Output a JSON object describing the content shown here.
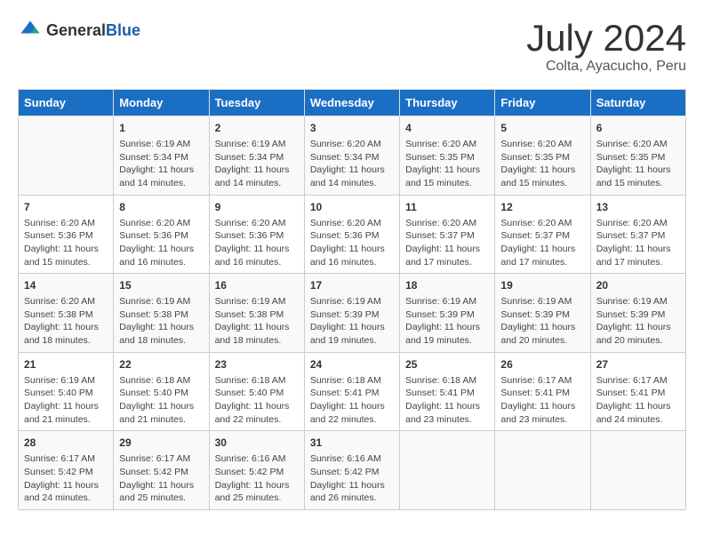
{
  "header": {
    "logo_general": "General",
    "logo_blue": "Blue",
    "title": "July 2024",
    "subtitle": "Colta, Ayacucho, Peru"
  },
  "weekdays": [
    "Sunday",
    "Monday",
    "Tuesday",
    "Wednesday",
    "Thursday",
    "Friday",
    "Saturday"
  ],
  "weeks": [
    [
      {
        "day": "",
        "content": ""
      },
      {
        "day": "1",
        "content": "Sunrise: 6:19 AM\nSunset: 5:34 PM\nDaylight: 11 hours\nand 14 minutes."
      },
      {
        "day": "2",
        "content": "Sunrise: 6:19 AM\nSunset: 5:34 PM\nDaylight: 11 hours\nand 14 minutes."
      },
      {
        "day": "3",
        "content": "Sunrise: 6:20 AM\nSunset: 5:34 PM\nDaylight: 11 hours\nand 14 minutes."
      },
      {
        "day": "4",
        "content": "Sunrise: 6:20 AM\nSunset: 5:35 PM\nDaylight: 11 hours\nand 15 minutes."
      },
      {
        "day": "5",
        "content": "Sunrise: 6:20 AM\nSunset: 5:35 PM\nDaylight: 11 hours\nand 15 minutes."
      },
      {
        "day": "6",
        "content": "Sunrise: 6:20 AM\nSunset: 5:35 PM\nDaylight: 11 hours\nand 15 minutes."
      }
    ],
    [
      {
        "day": "7",
        "content": "Sunrise: 6:20 AM\nSunset: 5:36 PM\nDaylight: 11 hours\nand 15 minutes."
      },
      {
        "day": "8",
        "content": "Sunrise: 6:20 AM\nSunset: 5:36 PM\nDaylight: 11 hours\nand 16 minutes."
      },
      {
        "day": "9",
        "content": "Sunrise: 6:20 AM\nSunset: 5:36 PM\nDaylight: 11 hours\nand 16 minutes."
      },
      {
        "day": "10",
        "content": "Sunrise: 6:20 AM\nSunset: 5:36 PM\nDaylight: 11 hours\nand 16 minutes."
      },
      {
        "day": "11",
        "content": "Sunrise: 6:20 AM\nSunset: 5:37 PM\nDaylight: 11 hours\nand 17 minutes."
      },
      {
        "day": "12",
        "content": "Sunrise: 6:20 AM\nSunset: 5:37 PM\nDaylight: 11 hours\nand 17 minutes."
      },
      {
        "day": "13",
        "content": "Sunrise: 6:20 AM\nSunset: 5:37 PM\nDaylight: 11 hours\nand 17 minutes."
      }
    ],
    [
      {
        "day": "14",
        "content": "Sunrise: 6:20 AM\nSunset: 5:38 PM\nDaylight: 11 hours\nand 18 minutes."
      },
      {
        "day": "15",
        "content": "Sunrise: 6:19 AM\nSunset: 5:38 PM\nDaylight: 11 hours\nand 18 minutes."
      },
      {
        "day": "16",
        "content": "Sunrise: 6:19 AM\nSunset: 5:38 PM\nDaylight: 11 hours\nand 18 minutes."
      },
      {
        "day": "17",
        "content": "Sunrise: 6:19 AM\nSunset: 5:39 PM\nDaylight: 11 hours\nand 19 minutes."
      },
      {
        "day": "18",
        "content": "Sunrise: 6:19 AM\nSunset: 5:39 PM\nDaylight: 11 hours\nand 19 minutes."
      },
      {
        "day": "19",
        "content": "Sunrise: 6:19 AM\nSunset: 5:39 PM\nDaylight: 11 hours\nand 20 minutes."
      },
      {
        "day": "20",
        "content": "Sunrise: 6:19 AM\nSunset: 5:39 PM\nDaylight: 11 hours\nand 20 minutes."
      }
    ],
    [
      {
        "day": "21",
        "content": "Sunrise: 6:19 AM\nSunset: 5:40 PM\nDaylight: 11 hours\nand 21 minutes."
      },
      {
        "day": "22",
        "content": "Sunrise: 6:18 AM\nSunset: 5:40 PM\nDaylight: 11 hours\nand 21 minutes."
      },
      {
        "day": "23",
        "content": "Sunrise: 6:18 AM\nSunset: 5:40 PM\nDaylight: 11 hours\nand 22 minutes."
      },
      {
        "day": "24",
        "content": "Sunrise: 6:18 AM\nSunset: 5:41 PM\nDaylight: 11 hours\nand 22 minutes."
      },
      {
        "day": "25",
        "content": "Sunrise: 6:18 AM\nSunset: 5:41 PM\nDaylight: 11 hours\nand 23 minutes."
      },
      {
        "day": "26",
        "content": "Sunrise: 6:17 AM\nSunset: 5:41 PM\nDaylight: 11 hours\nand 23 minutes."
      },
      {
        "day": "27",
        "content": "Sunrise: 6:17 AM\nSunset: 5:41 PM\nDaylight: 11 hours\nand 24 minutes."
      }
    ],
    [
      {
        "day": "28",
        "content": "Sunrise: 6:17 AM\nSunset: 5:42 PM\nDaylight: 11 hours\nand 24 minutes."
      },
      {
        "day": "29",
        "content": "Sunrise: 6:17 AM\nSunset: 5:42 PM\nDaylight: 11 hours\nand 25 minutes."
      },
      {
        "day": "30",
        "content": "Sunrise: 6:16 AM\nSunset: 5:42 PM\nDaylight: 11 hours\nand 25 minutes."
      },
      {
        "day": "31",
        "content": "Sunrise: 6:16 AM\nSunset: 5:42 PM\nDaylight: 11 hours\nand 26 minutes."
      },
      {
        "day": "",
        "content": ""
      },
      {
        "day": "",
        "content": ""
      },
      {
        "day": "",
        "content": ""
      }
    ]
  ]
}
